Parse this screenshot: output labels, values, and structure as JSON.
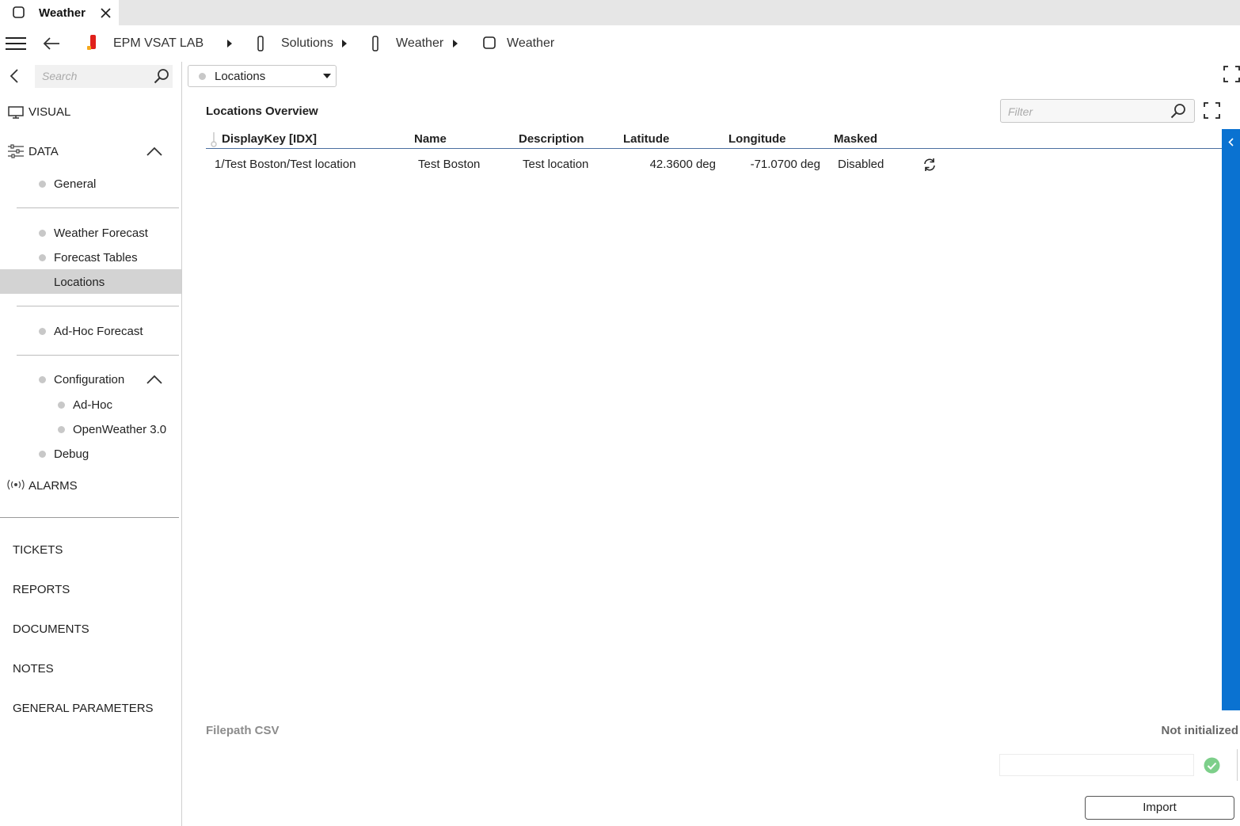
{
  "tab": {
    "title": "Weather"
  },
  "breadcrumb": {
    "root": "EPM VSAT LAB",
    "level1": "Solutions",
    "level2": "Weather",
    "level3": "Weather"
  },
  "sidebar": {
    "search_placeholder": "Search",
    "visual": "VISUAL",
    "data": "DATA",
    "items": {
      "general": "General",
      "weather_forecast": "Weather Forecast",
      "forecast_tables": "Forecast Tables",
      "locations": "Locations",
      "adhoc_forecast": "Ad-Hoc Forecast",
      "configuration": "Configuration",
      "adhoc": "Ad-Hoc",
      "openweather": "OpenWeather 3.0",
      "debug": "Debug"
    },
    "alarms": "ALARMS",
    "bottom": {
      "tickets": "TICKETS",
      "reports": "REPORTS",
      "documents": "DOCUMENTS",
      "notes": "NOTES",
      "general_parameters": "GENERAL PARAMETERS"
    }
  },
  "main": {
    "view_select": "Locations",
    "panel_title": "Locations Overview",
    "filter_placeholder": "Filter",
    "columns": {
      "displaykey": "DisplayKey [IDX]",
      "name": "Name",
      "description": "Description",
      "latitude": "Latitude",
      "longitude": "Longitude",
      "masked": "Masked"
    },
    "rows": [
      {
        "displaykey": "1/Test Boston/Test location",
        "name": "Test Boston",
        "description": "Test location",
        "latitude": "42.3600 deg",
        "longitude": "-71.0700 deg",
        "masked": "Disabled"
      }
    ],
    "csv_label": "Filepath CSV",
    "status": "Not initialized",
    "import_button": "Import"
  },
  "colors": {
    "accent": "#0a72d1",
    "selected_row": "#d3d3d3",
    "logo_red": "#e0201b",
    "logo_orange": "#f5a81c",
    "ok_green": "#7dcf8a"
  }
}
